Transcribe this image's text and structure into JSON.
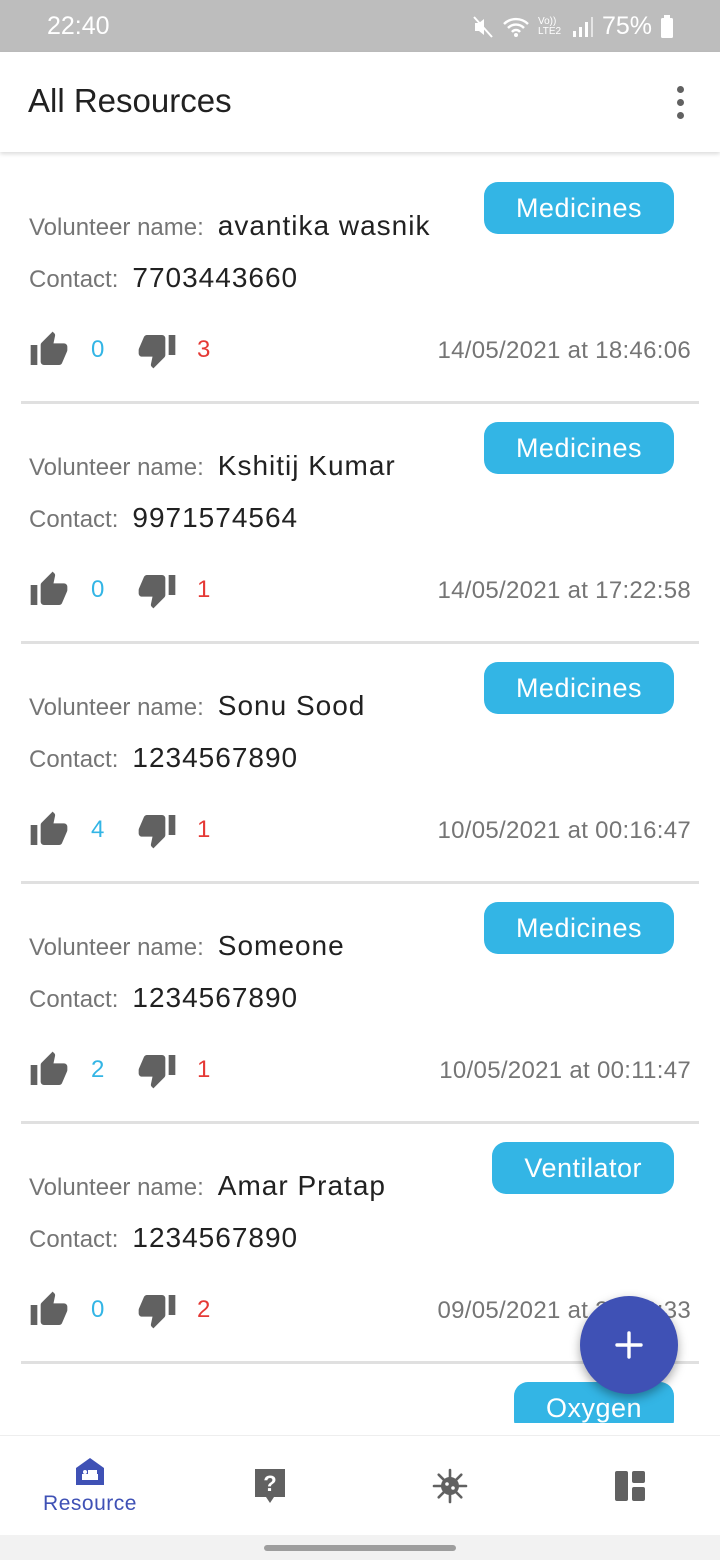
{
  "status_bar": {
    "time": "22:40",
    "network": "Vo)) LTE2",
    "battery": "75%"
  },
  "app_bar": {
    "title": "All Resources",
    "menu_icon": "more-vert-icon"
  },
  "labels": {
    "volunteer": "Volunteer name:",
    "contact": "Contact:"
  },
  "resources": [
    {
      "tag": "Medicines",
      "volunteer": "avantika wasnik",
      "contact": "7703443660",
      "upvotes": "0",
      "downvotes": "3",
      "timestamp": "14/05/2021 at 18:46:06"
    },
    {
      "tag": "Medicines",
      "volunteer": "Kshitij Kumar",
      "contact": "9971574564",
      "upvotes": "0",
      "downvotes": "1",
      "timestamp": "14/05/2021 at 17:22:58"
    },
    {
      "tag": "Medicines",
      "volunteer": "Sonu Sood",
      "contact": "1234567890",
      "upvotes": "4",
      "downvotes": "1",
      "timestamp": "10/05/2021 at 00:16:47"
    },
    {
      "tag": "Medicines",
      "volunteer": "Someone",
      "contact": "1234567890",
      "upvotes": "2",
      "downvotes": "1",
      "timestamp": "10/05/2021 at 00:11:47"
    },
    {
      "tag": "Ventilator",
      "volunteer": "Amar Pratap",
      "contact": "1234567890",
      "upvotes": "0",
      "downvotes": "2",
      "timestamp": "09/05/2021 at 23:33:33"
    },
    {
      "tag": "Oxygen",
      "volunteer": "",
      "contact": "",
      "upvotes": "",
      "downvotes": "",
      "timestamp": ""
    }
  ],
  "fab": {
    "icon": "add-icon"
  },
  "bottom_nav": {
    "items": [
      {
        "label": "Resource",
        "icon": "hospital-bed-icon",
        "active": true
      },
      {
        "label": "",
        "icon": "help-icon",
        "active": false
      },
      {
        "label": "",
        "icon": "virus-icon",
        "active": false
      },
      {
        "label": "",
        "icon": "dashboard-icon",
        "active": false
      }
    ]
  },
  "colors": {
    "accent": "#3f51b5",
    "tag": "#33b5e5",
    "upvote": "#33b5e5",
    "downvote": "#e53935"
  }
}
